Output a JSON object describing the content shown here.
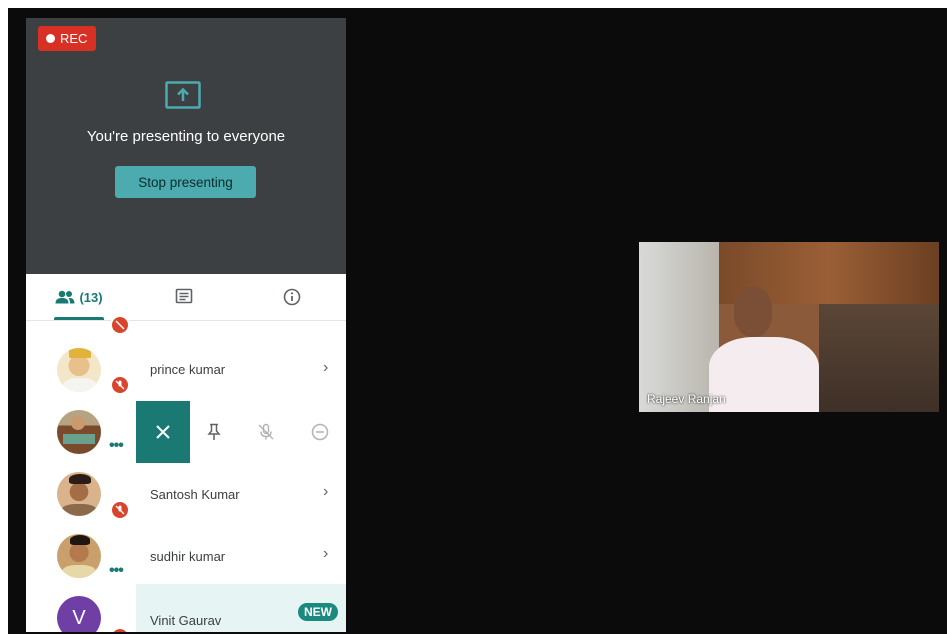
{
  "recording": {
    "label": "REC"
  },
  "presenting": {
    "message": "You're presenting to everyone",
    "stop_button": "Stop presenting"
  },
  "tabs": {
    "people_count": "(13)",
    "people_icon": "people-icon",
    "chat_icon": "chat-icon",
    "info_icon": "info-icon",
    "active": "people"
  },
  "participants": [
    {
      "name": "prince kumar",
      "muted": true
    },
    {
      "name": "",
      "muted": false,
      "actions": [
        "close-icon",
        "pin-icon",
        "mute-icon",
        "remove-icon"
      ]
    },
    {
      "name": "Santosh Kumar",
      "muted": true
    },
    {
      "name": "sudhir kumar",
      "muted": false
    },
    {
      "name": "Vinit Gaurav",
      "initial": "V",
      "badge": "NEW",
      "muted": true
    }
  ],
  "video_tile": {
    "name": "Rajeev Ranjan"
  },
  "colors": {
    "accent": "#1a7a73",
    "rec": "#d93025",
    "button": "#4cabaf",
    "presenting_bg": "#3c4043"
  }
}
